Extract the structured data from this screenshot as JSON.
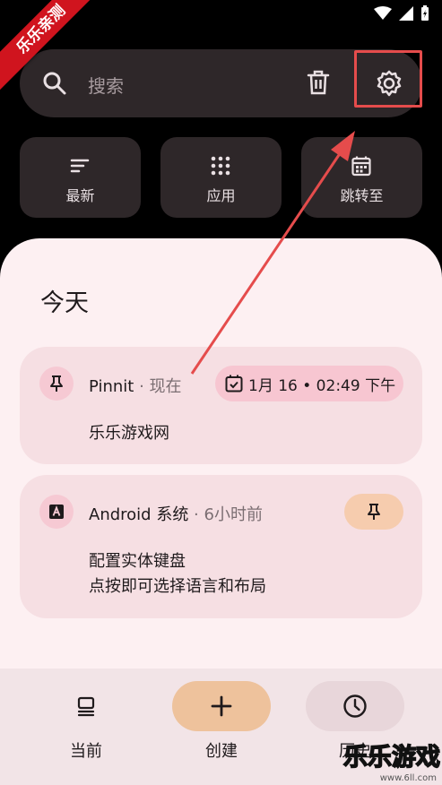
{
  "ribbon": {
    "label": "乐乐亲测"
  },
  "search": {
    "placeholder": "搜索"
  },
  "quick_actions": [
    {
      "label": "最新",
      "icon": "sort-icon"
    },
    {
      "label": "应用",
      "icon": "apps-grid-icon"
    },
    {
      "label": "跳转至",
      "icon": "calendar-icon"
    }
  ],
  "section": {
    "title": "今天"
  },
  "notifications": [
    {
      "app": "Pinnit",
      "meta": " · 现在",
      "chip": "1月 16 • 02:49 下午",
      "lines": [
        "乐乐游戏网"
      ]
    },
    {
      "app": "Android 系统",
      "meta": " · 6小时前",
      "lines": [
        "配置实体键盘",
        "点按即可选择语言和布局"
      ]
    }
  ],
  "nav": [
    {
      "label": "当前",
      "icon": "current-icon"
    },
    {
      "label": "创建",
      "icon": "plus-icon"
    },
    {
      "label": "历史",
      "icon": "clock-icon"
    }
  ],
  "watermark": {
    "label": "乐乐游戏",
    "url": "www.6ll.com"
  },
  "colors": {
    "accent_red": "#e54c4c",
    "create_pill": "#eec29c",
    "history_pill": "#e8d6da"
  }
}
